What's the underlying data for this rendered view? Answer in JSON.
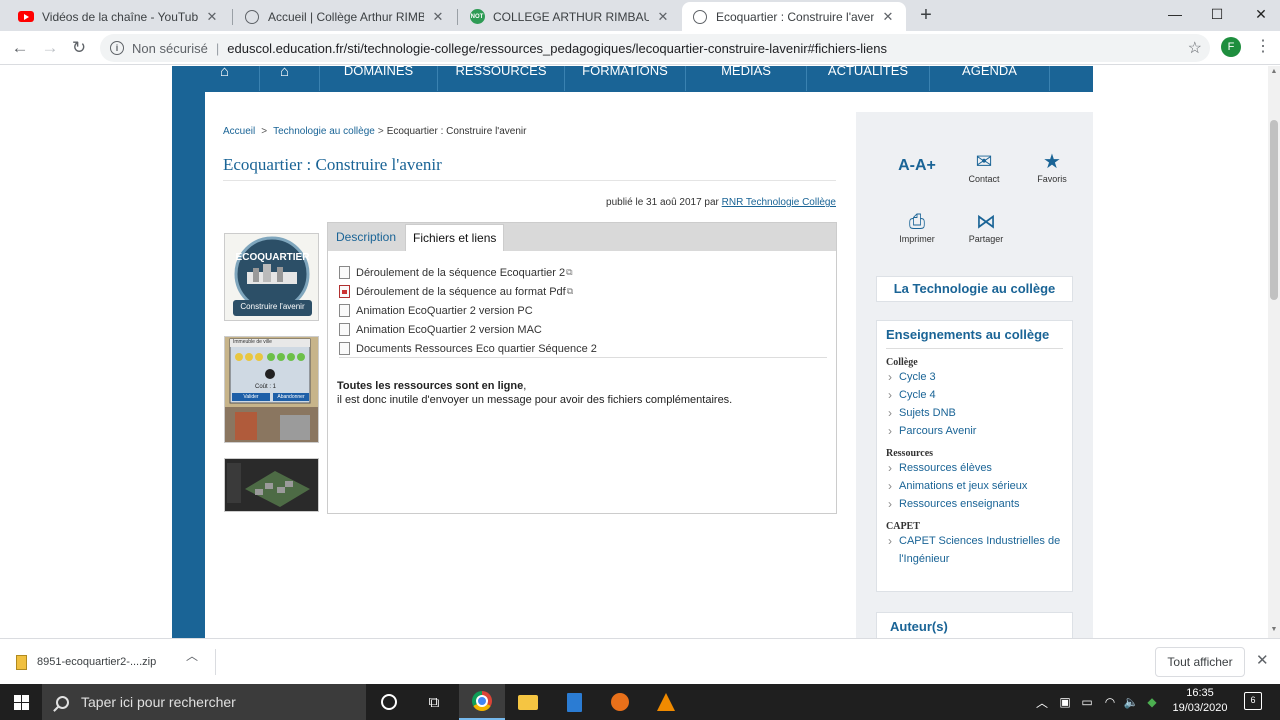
{
  "browser": {
    "tabs": [
      {
        "title": "Vidéos de la chaîne - YouTube St",
        "icon": "youtube-icon"
      },
      {
        "title": "Accueil | Collège Arthur RIMBAU",
        "icon": "globe-icon"
      },
      {
        "title": "COLLEGE ARTHUR RIMBAUD - PF",
        "icon": "ent-icon",
        "icon_text": "NOT"
      },
      {
        "title": "Ecoquartier : Construire l'avenir",
        "icon": "globe-icon"
      }
    ],
    "new_tab": "+",
    "window_controls": {
      "minimize": "—",
      "maximize": "☐",
      "close": "✕"
    },
    "nav": {
      "back": "←",
      "forward": "→",
      "reload": "↻"
    },
    "address": {
      "security": "Non sécurisé",
      "url": "eduscol.education.fr/sti/technologie-college/ressources_pedagogiques/lecoquartier-construire-lavenir#fichiers-liens"
    },
    "profile_initial": "F"
  },
  "site": {
    "nav": [
      "DOMAINES",
      "RESSOURCES",
      "FORMATIONS",
      "MEDIAS",
      "ACTUALITES",
      "AGENDA"
    ],
    "breadcrumb": {
      "home": "Accueil",
      "section": "Technologie au collège",
      "current": "Ecoquartier : Construire l'avenir",
      "separator": ">"
    },
    "title": "Ecoquartier : Construire l'avenir",
    "published": {
      "prefix": "publié le 31 aoû 2017 par",
      "author": "RNR Technologie Collège"
    },
    "tabs": {
      "description": "Description",
      "files": "Fichiers et liens"
    },
    "files": [
      {
        "label": "Déroulement de la séquence Ecoquartier 2",
        "type": "doc",
        "external": true
      },
      {
        "label": "Déroulement de la séquence au format Pdf",
        "type": "pdf",
        "external": true
      },
      {
        "label": "Animation EcoQuartier 2 version PC",
        "type": "doc",
        "external": false
      },
      {
        "label": "Animation EcoQuartier 2 version MAC",
        "type": "doc",
        "external": false
      },
      {
        "label": "Documents Ressources Eco quartier Séquence 2",
        "type": "doc",
        "external": false
      }
    ],
    "note": {
      "bold": "Toutes les ressources sont en ligne",
      "comma": ",",
      "rest": "il est donc inutile d'envoyer un message pour avoir des fichiers complémentaires."
    },
    "thumbs": {
      "logo_top": "ECOQUARTIER",
      "logo_bottom": "Construire l'avenir",
      "game_title": "Immeuble de ville",
      "game_cost": "Coût : 1",
      "game_ok": "Valider",
      "game_cancel": "Abandonner"
    }
  },
  "sidebar": {
    "tools": {
      "font_size": "A-A+",
      "contact": "Contact",
      "favorites": "Favoris",
      "print": "Imprimer",
      "share": "Partager"
    },
    "tech_link": "La Technologie au collège",
    "teaching": {
      "title": "Enseignements au collège",
      "groups": [
        {
          "heading": "Collège",
          "links": [
            "Cycle 3",
            "Cycle 4",
            "Sujets DNB",
            "Parcours Avenir"
          ]
        },
        {
          "heading": "Ressources",
          "links": [
            "Ressources élèves",
            "Animations et jeux sérieux",
            "Ressources enseignants"
          ]
        },
        {
          "heading": "CAPET",
          "links": [
            "CAPET Sciences Industrielles de",
            "l'Ingénieur"
          ]
        }
      ]
    },
    "authors_title": "Auteur(s)"
  },
  "downloads": {
    "file": "8951-ecoquartier2-....zip",
    "show_all": "Tout afficher"
  },
  "taskbar": {
    "search_placeholder": "Taper ici pour rechercher",
    "time": "16:35",
    "date": "19/03/2020",
    "notification_count": "6"
  },
  "colors": {
    "site_blue": "#1a6496",
    "sidebar_bg": "#eef0f3",
    "taskbar": "#1f1f1f"
  }
}
